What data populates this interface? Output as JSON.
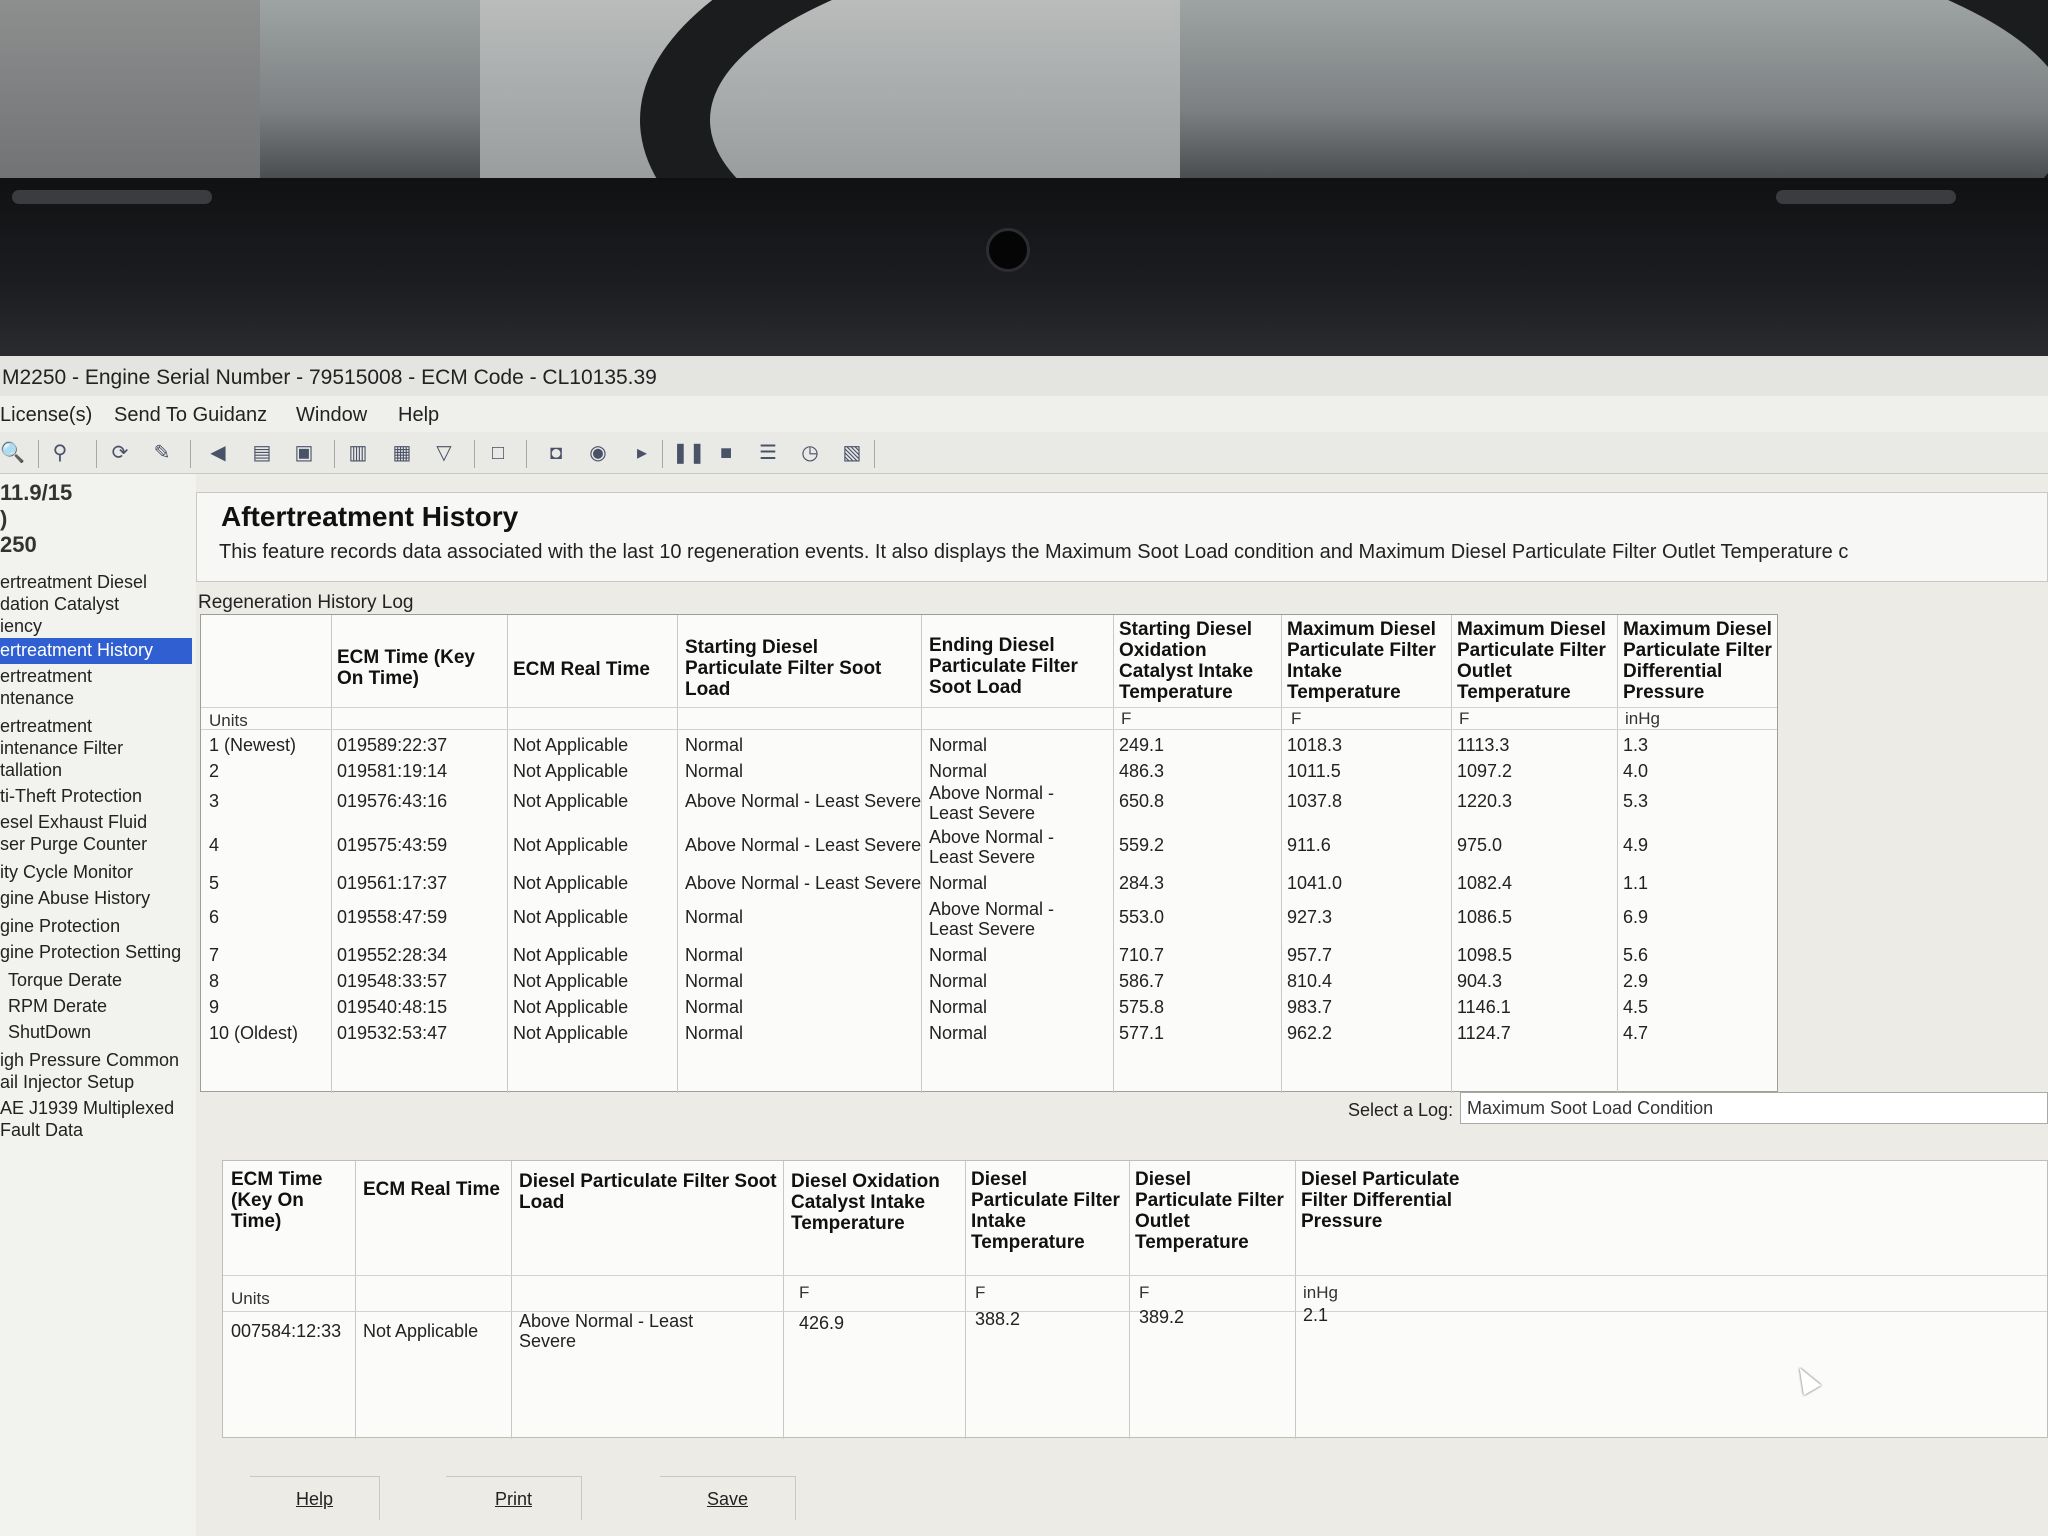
{
  "window": {
    "title": "M2250 - Engine Serial Number - 79515008 - ECM Code - CL10135.39"
  },
  "menu": [
    "License(s)",
    "Send To Guidanz",
    "Window",
    "Help"
  ],
  "toolbar_icons": [
    "search-icon",
    "binoculars-icon",
    "refresh-icon",
    "wrench-icon",
    "horn-icon",
    "documents-icon",
    "printer-icon",
    "page-icon",
    "page-alt-icon",
    "filter-icon",
    "frame-icon",
    "camera-icon",
    "record-icon",
    "play-icon",
    "pause-icon",
    "stop-icon",
    "list-icon",
    "clock-icon",
    "report-icon"
  ],
  "sidebar": {
    "version_lines": [
      "11.9/15",
      ")",
      "250"
    ],
    "items": [
      "ertreatment Diesel",
      "dation Catalyst",
      "iency",
      "ertreatment History",
      "ertreatment",
      "ntenance",
      "ertreatment",
      "intenance Filter",
      "tallation",
      "ti-Theft Protection",
      "esel Exhaust Fluid",
      "ser Purge Counter",
      "ity Cycle Monitor",
      "gine Abuse History",
      "gine Protection",
      "gine Protection Setting",
      "Torque Derate",
      "RPM Derate",
      "ShutDown",
      "igh Pressure Common",
      "ail Injector Setup",
      "AE J1939 Multiplexed",
      "Fault Data"
    ],
    "selected_index": 3
  },
  "page": {
    "title": "Aftertreatment History",
    "description": "This feature records data associated with the last 10 regeneration events. It also displays the Maximum Soot Load condition and Maximum Diesel Particulate Filter Outlet Temperature c",
    "log_label": "Regeneration History Log"
  },
  "history_table": {
    "headers": [
      "",
      "ECM Time (Key On Time)",
      "ECM Real Time",
      "Starting Diesel Particulate Filter Soot Load",
      "Ending Diesel Particulate Filter Soot Load",
      "Starting Diesel Oxidation Catalyst Intake Temperature",
      "Maximum Diesel Particulate Filter Intake Temperature",
      "Maximum Diesel Particulate Filter Outlet Temperature",
      "Maximum Diesel Particulate Filter Differential Pressure"
    ],
    "units": [
      "Units",
      "",
      "",
      "",
      "",
      "F",
      "F",
      "F",
      "inHg"
    ],
    "rows": [
      [
        "1 (Newest)",
        "019589:22:37",
        "Not Applicable",
        "Normal",
        "Normal",
        "249.1",
        "1018.3",
        "1113.3",
        "1.3"
      ],
      [
        "2",
        "019581:19:14",
        "Not Applicable",
        "Normal",
        "Normal",
        "486.3",
        "1011.5",
        "1097.2",
        "4.0"
      ],
      [
        "3",
        "019576:43:16",
        "Not Applicable",
        "Above Normal - Least Severe",
        "Above Normal - Least Severe",
        "650.8",
        "1037.8",
        "1220.3",
        "5.3"
      ],
      [
        "4",
        "019575:43:59",
        "Not Applicable",
        "Above Normal - Least Severe",
        "Above Normal - Least Severe",
        "559.2",
        "911.6",
        "975.0",
        "4.9"
      ],
      [
        "5",
        "019561:17:37",
        "Not Applicable",
        "Above Normal - Least Severe",
        "Normal",
        "284.3",
        "1041.0",
        "1082.4",
        "1.1"
      ],
      [
        "6",
        "019558:47:59",
        "Not Applicable",
        "Normal",
        "Above Normal - Least Severe",
        "553.0",
        "927.3",
        "1086.5",
        "6.9"
      ],
      [
        "7",
        "019552:28:34",
        "Not Applicable",
        "Normal",
        "Normal",
        "710.7",
        "957.7",
        "1098.5",
        "5.6"
      ],
      [
        "8",
        "019548:33:57",
        "Not Applicable",
        "Normal",
        "Normal",
        "586.7",
        "810.4",
        "904.3",
        "2.9"
      ],
      [
        "9",
        "019540:48:15",
        "Not Applicable",
        "Normal",
        "Normal",
        "575.8",
        "983.7",
        "1146.1",
        "4.5"
      ],
      [
        "10 (Oldest)",
        "019532:53:47",
        "Not Applicable",
        "Normal",
        "Normal",
        "577.1",
        "962.2",
        "1124.7",
        "4.7"
      ]
    ]
  },
  "select_log": {
    "label": "Select a Log:",
    "value": "Maximum Soot Load Condition"
  },
  "detail_table": {
    "headers": [
      "ECM Time (Key On Time)",
      "ECM Real Time",
      "Diesel Particulate Filter Soot Load",
      "Diesel Oxidation Catalyst Intake Temperature",
      "Diesel Particulate Filter Intake Temperature",
      "Diesel Particulate Filter Outlet Temperature",
      "Diesel Particulate Filter Differential Pressure"
    ],
    "units_label": "Units",
    "units": [
      "",
      "",
      "",
      "F",
      "F",
      "F",
      "inHg"
    ],
    "row": [
      "007584:12:33",
      "Not Applicable",
      "Above Normal - Least Severe",
      "426.9",
      "388.2",
      "389.2",
      "2.1"
    ]
  },
  "buttons": {
    "help": "Help",
    "print": "Print",
    "save": "Save"
  }
}
